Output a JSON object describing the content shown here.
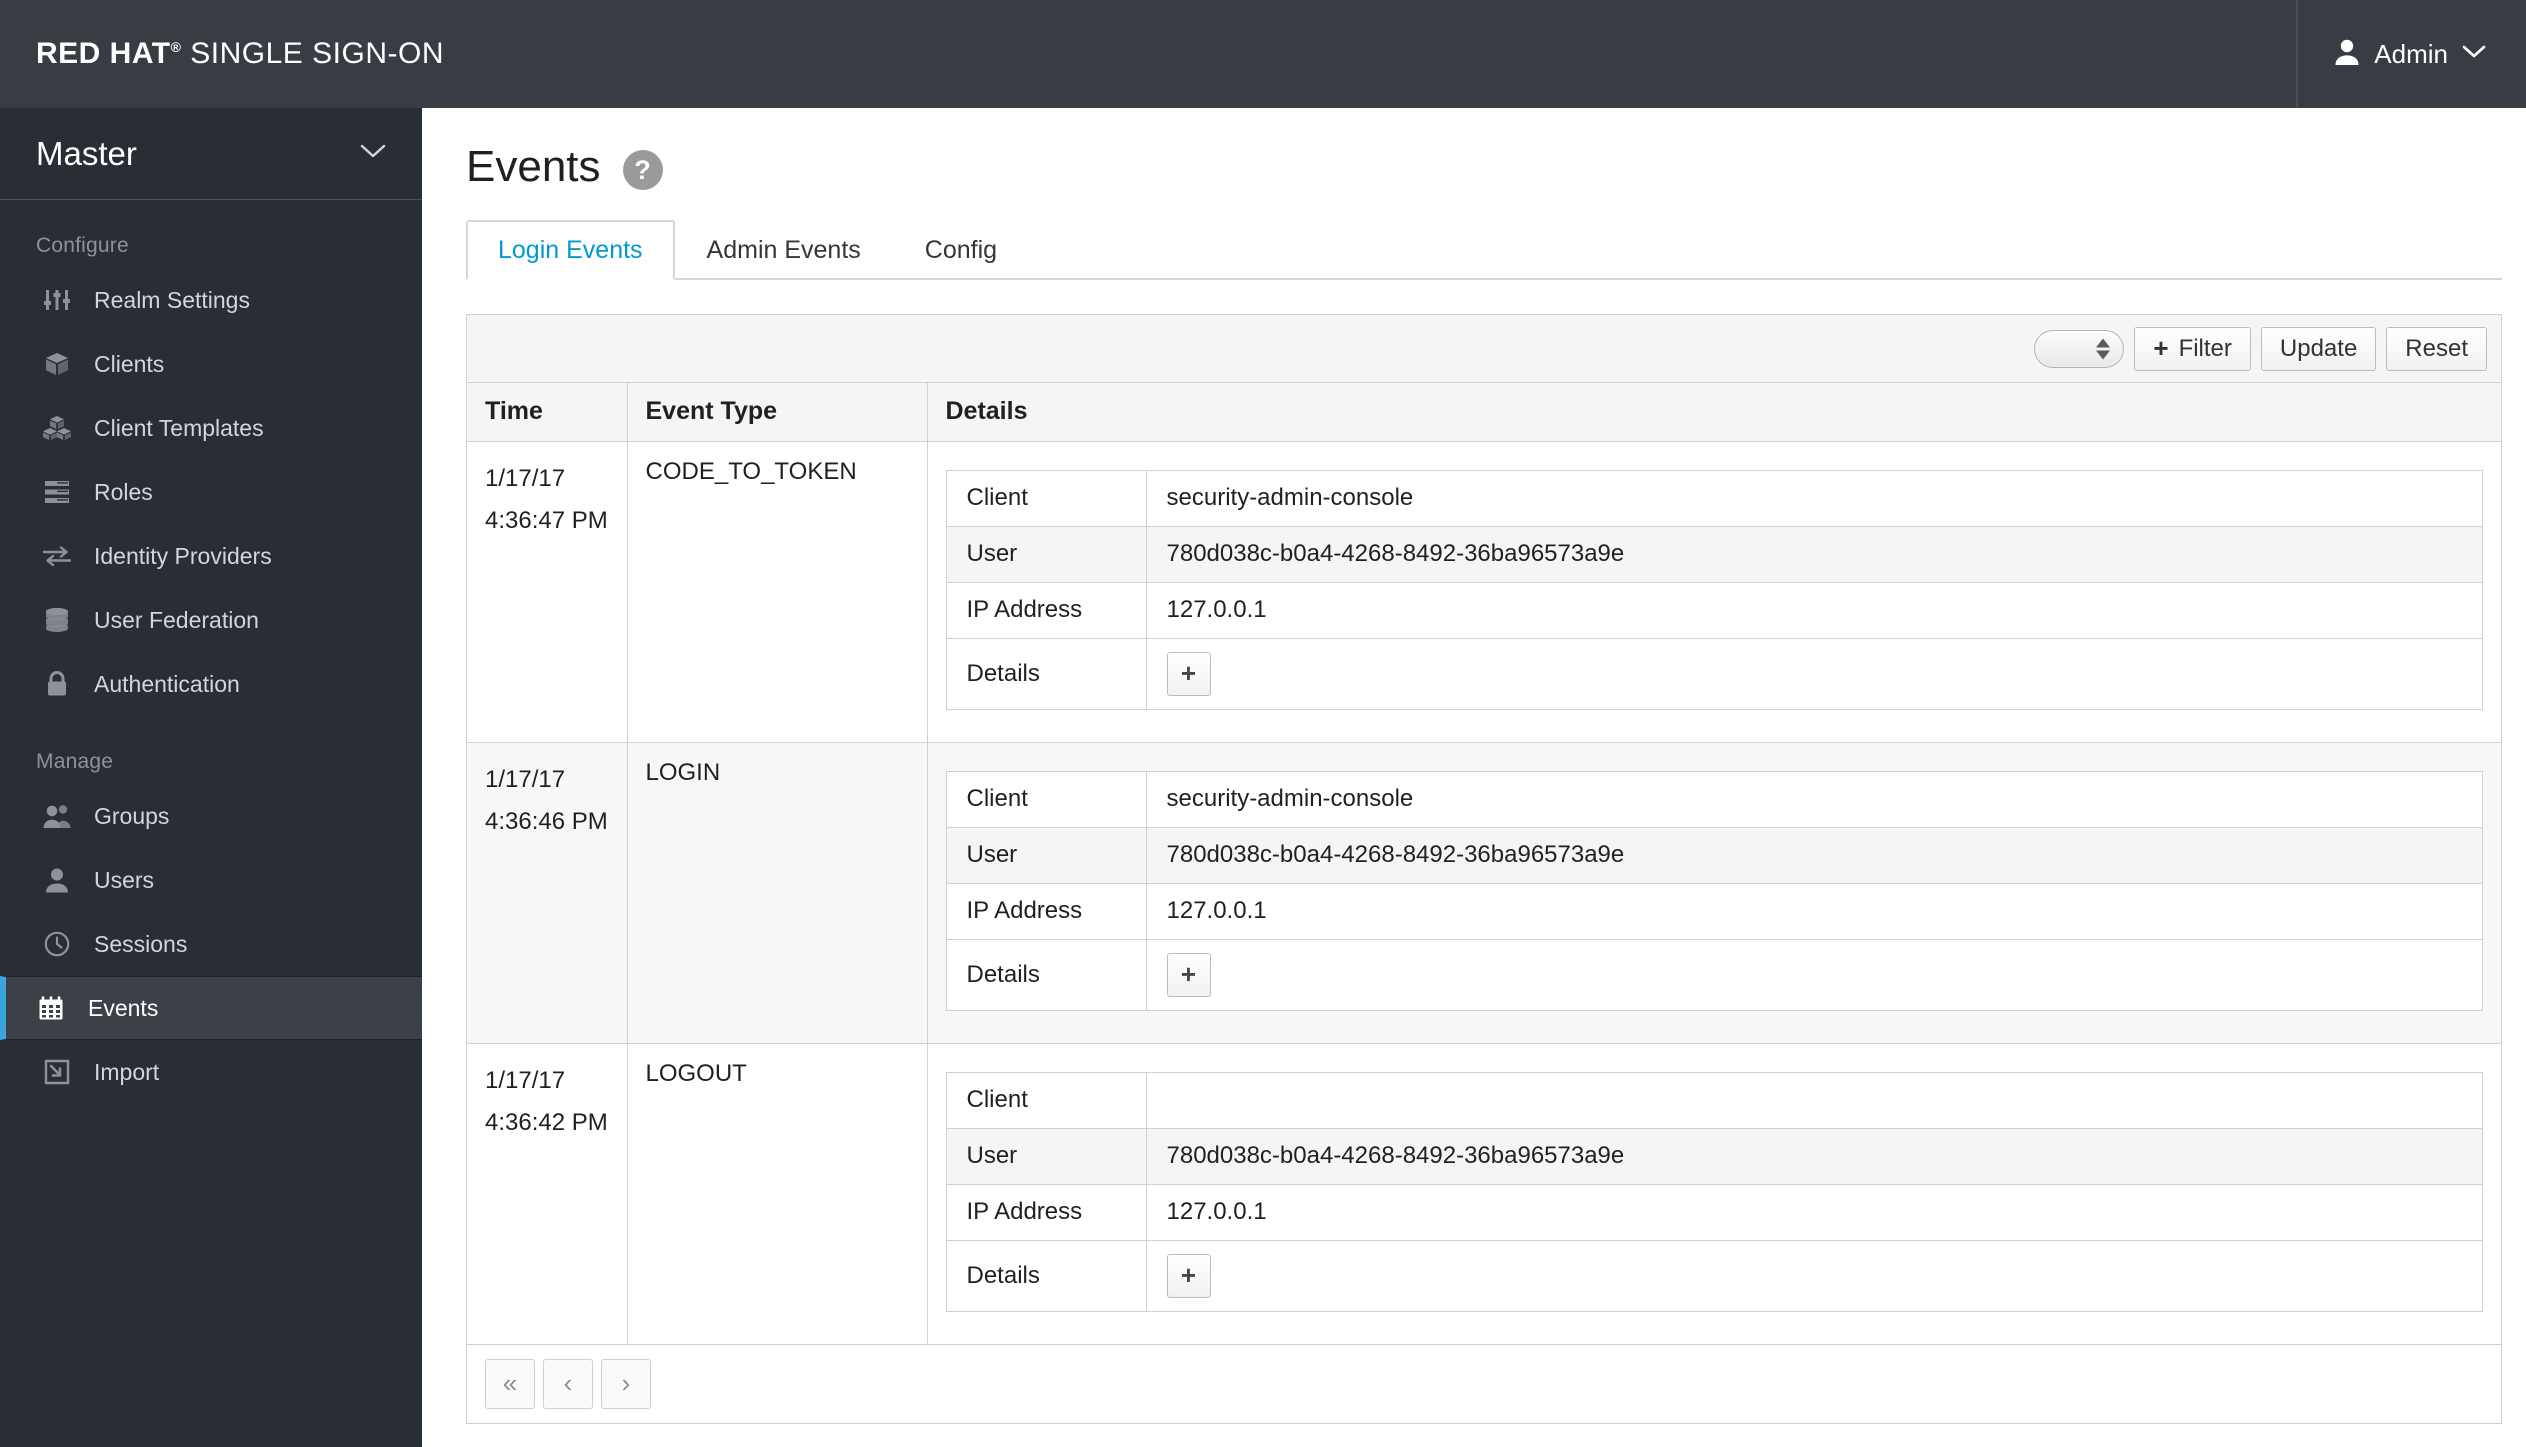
{
  "navbar": {
    "brand_redhat": "RED HAT",
    "brand_registered": "®",
    "brand_product": "SINGLE SIGN-ON",
    "user_name": "Admin"
  },
  "sidebar": {
    "realm": "Master",
    "sections": [
      {
        "label": "Configure",
        "items": [
          {
            "label": "Realm Settings",
            "icon": "sliders-icon",
            "active": false
          },
          {
            "label": "Clients",
            "icon": "cube-icon",
            "active": false
          },
          {
            "label": "Client Templates",
            "icon": "cubes-icon",
            "active": false
          },
          {
            "label": "Roles",
            "icon": "list-icon",
            "active": false
          },
          {
            "label": "Identity Providers",
            "icon": "exchange-icon",
            "active": false
          },
          {
            "label": "User Federation",
            "icon": "database-icon",
            "active": false
          },
          {
            "label": "Authentication",
            "icon": "lock-icon",
            "active": false
          }
        ]
      },
      {
        "label": "Manage",
        "items": [
          {
            "label": "Groups",
            "icon": "users-icon",
            "active": false
          },
          {
            "label": "Users",
            "icon": "user-icon",
            "active": false
          },
          {
            "label": "Sessions",
            "icon": "clock-icon",
            "active": false
          },
          {
            "label": "Events",
            "icon": "calendar-icon",
            "active": true
          },
          {
            "label": "Import",
            "icon": "import-icon",
            "active": false
          }
        ]
      }
    ]
  },
  "main": {
    "page_title": "Events",
    "help_glyph": "?",
    "tabs": [
      {
        "label": "Login Events",
        "active": true
      },
      {
        "label": "Admin Events",
        "active": false
      },
      {
        "label": "Config",
        "active": false
      }
    ],
    "toolbar": {
      "select_value": "",
      "filter_label": "Filter",
      "filter_plus": "+",
      "update_label": "Update",
      "reset_label": "Reset"
    },
    "table": {
      "headers": [
        "Time",
        "Event Type",
        "Details"
      ],
      "detail_keys": [
        "Client",
        "User",
        "IP Address",
        "Details"
      ],
      "details_expand_glyph": "+",
      "rows": [
        {
          "date": "1/17/17",
          "time": "4:36:47 PM",
          "event_type": "CODE_TO_TOKEN",
          "striped": false,
          "client": "security-admin-console",
          "user": "780d038c-b0a4-4268-8492-36ba96573a9e",
          "ip_address": "127.0.0.1"
        },
        {
          "date": "1/17/17",
          "time": "4:36:46 PM",
          "event_type": "LOGIN",
          "striped": true,
          "client": "security-admin-console",
          "user": "780d038c-b0a4-4268-8492-36ba96573a9e",
          "ip_address": "127.0.0.1"
        },
        {
          "date": "1/17/17",
          "time": "4:36:42 PM",
          "event_type": "LOGOUT",
          "striped": false,
          "client": "",
          "user": "780d038c-b0a4-4268-8492-36ba96573a9e",
          "ip_address": "127.0.0.1"
        }
      ]
    },
    "pagination": {
      "first_label": "«",
      "prev_label": "‹",
      "next_label": "›"
    }
  },
  "colors": {
    "navbar_bg": "#383d44",
    "sidebar_bg": "#292e34",
    "active_accent": "#39a5dc",
    "tab_active_text": "#0099d3"
  }
}
